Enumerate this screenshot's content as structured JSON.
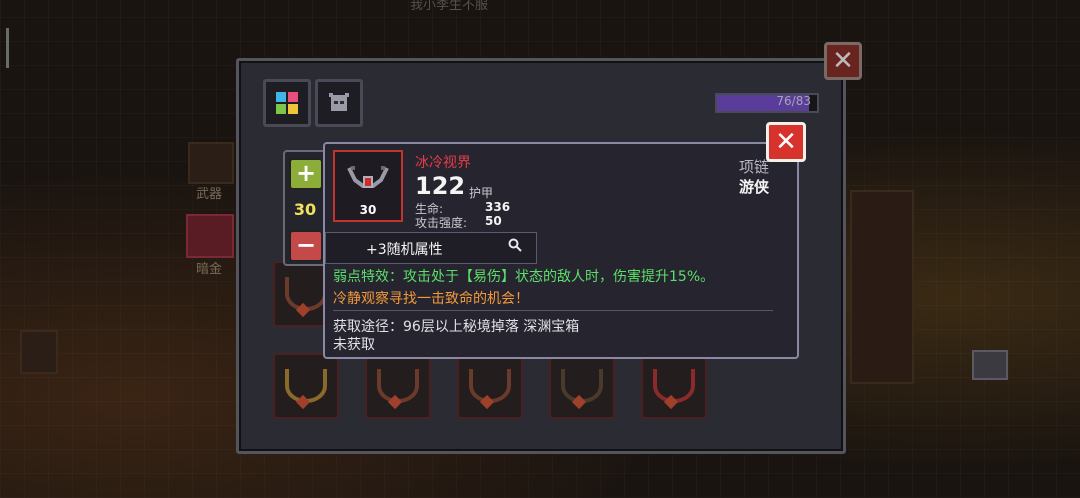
{
  "background": {
    "top_text": "我小李生不服",
    "side_labels": [
      "武器",
      "暗金"
    ]
  },
  "panel": {
    "capacity_text": "76/83",
    "capacity_fraction": 0.916
  },
  "stepper": {
    "plus": "+",
    "value": "30",
    "minus": "−"
  },
  "tooltip": {
    "close_label": "✕",
    "item_level": "30",
    "item_name": "冰冷视界",
    "armor_value": "122",
    "armor_label": "护甲",
    "stats": [
      {
        "label": "生命:",
        "value": "336"
      },
      {
        "label": "攻击强度:",
        "value": "50"
      }
    ],
    "category": "项链",
    "class_name": "游侠",
    "random_attr": "+3随机属性",
    "effect_green": "弱点特效：攻击处于【易伤】状态的敌人时，伤害提升15%。",
    "effect_orange": "冷静观察寻找一击致命的机会！",
    "source": "获取途径：96层以上秘境掉落 深渊宝箱",
    "status": "未获取"
  },
  "outer_close_label": "✕",
  "colors": {
    "rarity_red": "#e43d4a",
    "effect_green": "#5ce06a",
    "flavor_orange": "#f29a3a",
    "level_yellow": "#f0e05a"
  }
}
